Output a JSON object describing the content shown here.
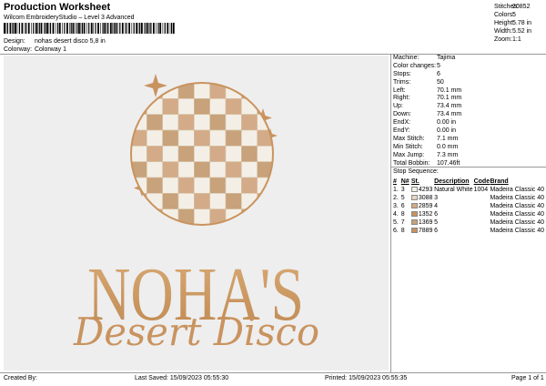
{
  "header": {
    "title": "Production Worksheet",
    "subtitle": "Wilcom EmbroideryStudio – Level 3 Advanced"
  },
  "design": {
    "design_label": "Design:",
    "design_value": "nohas desert disco 5,8 in",
    "colorway_label": "Colorway:",
    "colorway_value": "Colorway 1"
  },
  "stats": [
    {
      "label": "Stitches:",
      "value": "20852"
    },
    {
      "label": "Colors:",
      "value": "5"
    },
    {
      "label": "Height:",
      "value": "5.78 in"
    },
    {
      "label": "Width:",
      "value": "5.52 in"
    },
    {
      "label": "Zoom:",
      "value": "1:1"
    }
  ],
  "artwork": {
    "logo_text": "NOHA'S",
    "script_text": "Desert Disco"
  },
  "machine_info": [
    {
      "label": "Machine:",
      "value": "Tajima"
    },
    {
      "label": "Color changes:",
      "value": "5"
    },
    {
      "label": "Stops:",
      "value": "6"
    },
    {
      "label": "Trims:",
      "value": "50"
    },
    {
      "label": "Left:",
      "value": "70.1 mm"
    },
    {
      "label": "Right:",
      "value": "70.1 mm"
    },
    {
      "label": "Up:",
      "value": "73.4 mm"
    },
    {
      "label": "Down:",
      "value": "73.4 mm"
    },
    {
      "label": "EndX:",
      "value": "0.00 in"
    },
    {
      "label": "EndY:",
      "value": "0.00 in"
    },
    {
      "label": "Max Stitch:",
      "value": "7.1 mm"
    },
    {
      "label": "Min Stitch:",
      "value": "0.0 mm"
    },
    {
      "label": "Max Jump:",
      "value": "7.3 mm"
    },
    {
      "label": "Total Bobbin:",
      "value": "107.46ft"
    }
  ],
  "sequence": {
    "title": "Stop Sequence:",
    "headers": [
      "#",
      "N#",
      "St.",
      "Description",
      "Code",
      "Brand"
    ],
    "rows": [
      {
        "num": "1.",
        "n": "3",
        "st": "4293",
        "desc": "Natural White",
        "code": "1004",
        "brand": "Madeira Classic 40",
        "color": "#f3efe6"
      },
      {
        "num": "2.",
        "n": "5",
        "st": "3088",
        "desc": "3",
        "code": "",
        "brand": "Madeira Classic 40",
        "color": "#ead3bf"
      },
      {
        "num": "3.",
        "n": "6",
        "st": "2859",
        "desc": "4",
        "code": "",
        "brand": "Madeira Classic 40",
        "color": "#d3ab88"
      },
      {
        "num": "4.",
        "n": "8",
        "st": "1352",
        "desc": "6",
        "code": "",
        "brand": "Madeira Classic 40",
        "color": "#c9935f"
      },
      {
        "num": "5.",
        "n": "7",
        "st": "1369",
        "desc": "5",
        "code": "",
        "brand": "Madeira Classic 40",
        "color": "#c7a27a"
      },
      {
        "num": "6.",
        "n": "8",
        "st": "7889",
        "desc": "6",
        "code": "",
        "brand": "Madeira Classic 40",
        "color": "#c9935f"
      }
    ]
  },
  "footer": {
    "created_by": "Created By:",
    "last_saved": "Last Saved: 15/09/2023 05:55:30",
    "printed": "Printed: 15/09/2023 05:55:35",
    "page": "Page 1 of 1"
  },
  "colors": {
    "canvas_bg": "#eeeeee",
    "thread_gold": "#c9935f",
    "thread_light": "#ead3bf",
    "thread_white": "#f3efe6"
  }
}
